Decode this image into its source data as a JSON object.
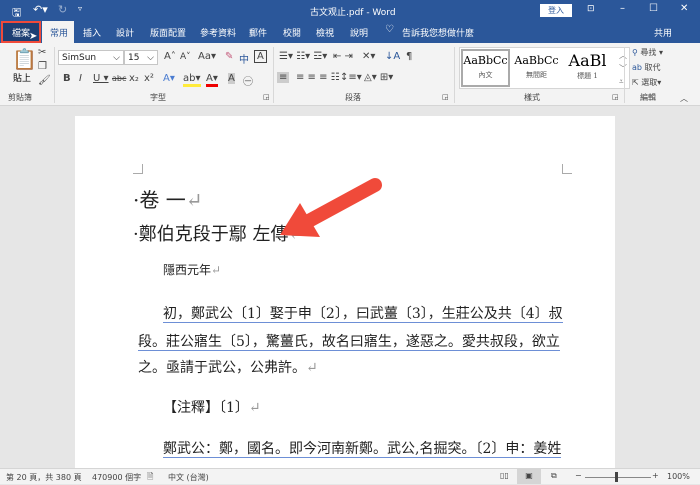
{
  "title": "古文观止.pdf - Word",
  "signin": "登入",
  "tabs": [
    "檔案",
    "常用",
    "插入",
    "設計",
    "版面配置",
    "參考資料",
    "郵件",
    "校閱",
    "檢視",
    "說明"
  ],
  "tell_me": "告訴我您想做什麼",
  "share": "共用",
  "ribbon": {
    "paste": "貼上",
    "clipboard": "剪貼簿",
    "font_name": "SimSun",
    "font_size": "15",
    "font_group": "字型",
    "para_group": "段落",
    "styles": [
      {
        "preview": "AaBbCc",
        "name": "內文"
      },
      {
        "preview": "AaBbCc",
        "name": "無間距"
      },
      {
        "preview": "AaBl",
        "name": "標題 1"
      }
    ],
    "styles_group": "樣式",
    "find": "尋找",
    "replace": "取代",
    "select": "選取",
    "edit_group": "編輯"
  },
  "doc": {
    "h1": "卷 一",
    "h2a": "鄭伯克段于鄢",
    "h2b": "左傳",
    "year": "隱西元年",
    "p1": "初，鄭武公〔1〕娶于申〔2〕，曰武薑〔3〕，生莊公及共〔4〕叔",
    "p2": "段。莊公寤生〔5〕，驚薑氏，故名曰寤生，遂惡之。愛共叔段，欲立",
    "p3": "之。亟請于武公，公弗許。",
    "note": "【注釋】〔1〕",
    "p4": "鄭武公：鄭，國名。即今河南新鄭。武公,名掘突。〔2〕申：姜姓"
  },
  "status": {
    "page": "第 20 頁，共 380 頁",
    "words": "470900 個字",
    "lang": "中文 (台灣)",
    "zoom": "100%"
  },
  "zoom_level": 100,
  "colors": {
    "accent": "#2b579a",
    "highlight": "#f04a3a"
  }
}
